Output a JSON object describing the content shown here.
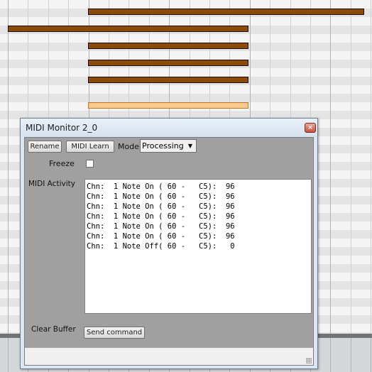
{
  "window": {
    "title": "MIDI Monitor 2_0",
    "close_glyph": "×"
  },
  "toolbar": {
    "rename_label": "Rename",
    "midi_learn_label": "MIDI Learn",
    "mode_label": "Mode",
    "mode_value": "Processing",
    "mode_arrow": "▼"
  },
  "freeze": {
    "label": "Freeze",
    "checked": false
  },
  "activity": {
    "label": "MIDI Activity",
    "lines": [
      "Chn:  1 Note On ( 60 -   C5):  96",
      "Chn:  1 Note On ( 60 -   C5):  96",
      "Chn:  1 Note On ( 60 -   C5):  96",
      "Chn:  1 Note On ( 60 -   C5):  96",
      "Chn:  1 Note On ( 60 -   C5):  96",
      "Chn:  1 Note On ( 60 -   C5):  96",
      "Chn:  1 Note Off( 60 -   C5):   0"
    ]
  },
  "clear_buffer": {
    "label": "Clear Buffer",
    "button_label": "Send command"
  },
  "colors": {
    "note_fill": "#8a4a08",
    "note_selected_fill": "#fdc98a",
    "panel_gray": "#a0a0a0"
  }
}
